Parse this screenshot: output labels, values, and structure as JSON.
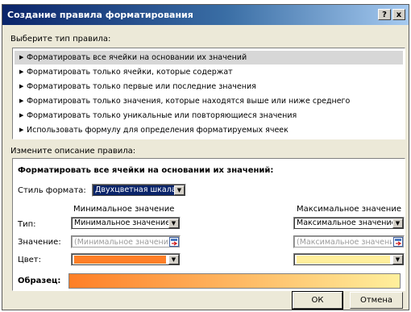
{
  "window": {
    "title": "Создание правила форматирования",
    "help_label": "?",
    "close_label": "x"
  },
  "rule_type": {
    "label": "Выберите тип правила:",
    "items": [
      "Форматировать все ячейки на основании их значений",
      "Форматировать только ячейки, которые содержат",
      "Форматировать только первые или последние значения",
      "Форматировать только значения, которые находятся выше или ниже среднего",
      "Форматировать только уникальные или повторяющиеся значения",
      "Использовать формулу для определения форматируемых ячеек"
    ],
    "selected_index": 0
  },
  "description": {
    "label": "Измените описание правила:",
    "heading": "Форматировать все ячейки на основании их значений:",
    "style_label": "Стиль формата:",
    "style_value": "Двухцветная шкала",
    "min_header": "Минимальное значение",
    "max_header": "Максимальное значение",
    "type_label": "Тип:",
    "min_type": "Минимальное значение",
    "max_type": "Максимальное значение",
    "value_label": "Значение:",
    "min_value_placeholder": "(Минимальное значение)",
    "max_value_placeholder": "(Максимальное значение)",
    "color_label": "Цвет:",
    "min_color": "#ff7f27",
    "max_color": "#ffef9c",
    "sample_label": "Образец:"
  },
  "buttons": {
    "ok": "ОК",
    "cancel": "Отмена"
  }
}
